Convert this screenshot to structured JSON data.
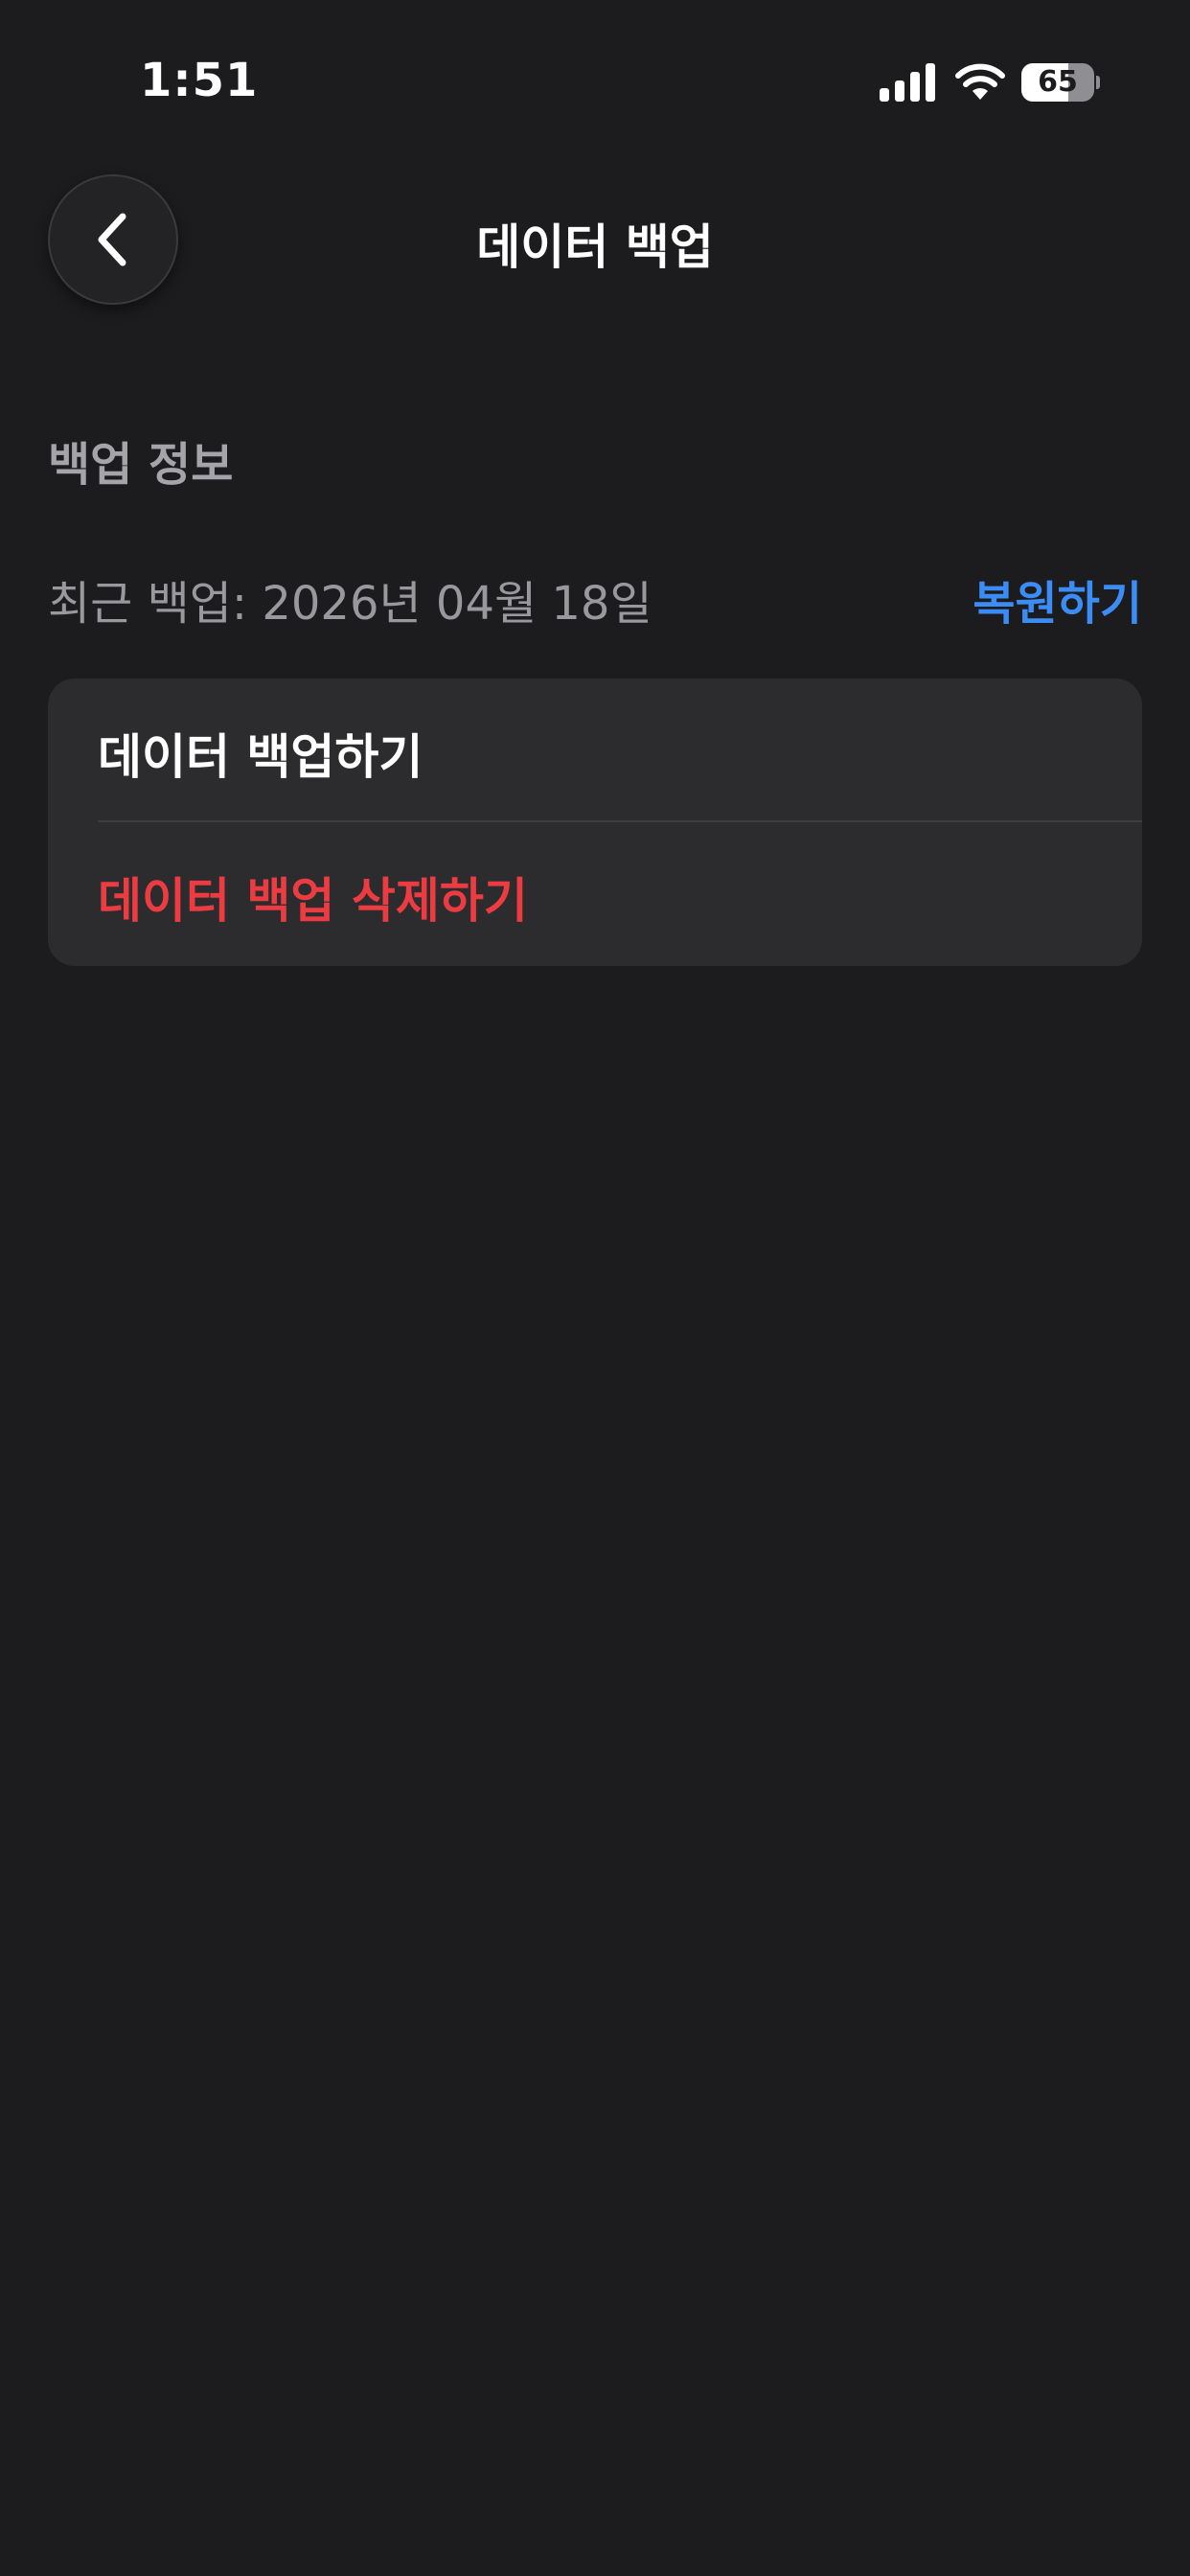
{
  "status_bar": {
    "time": "1:51",
    "battery_percent": "65",
    "battery_level": 0.65,
    "icons": [
      "signal-icon",
      "wifi-icon",
      "battery-icon"
    ]
  },
  "header": {
    "back_icon": "chevron-left-icon",
    "title": "데이터 백업"
  },
  "backup_info": {
    "section_title": "백업 정보",
    "last_backup": "최근 백업: 2026년 04월 18일",
    "restore_label": "복원하기"
  },
  "actions": {
    "backup_label": "데이터 백업하기",
    "delete_label": "데이터 백업 삭제하기"
  },
  "colors": {
    "background": "#1c1c1e",
    "card": "#2c2c2e",
    "accent": "#3b8cf5",
    "destructive": "#ec3c41",
    "secondary_text": "#98989d"
  }
}
